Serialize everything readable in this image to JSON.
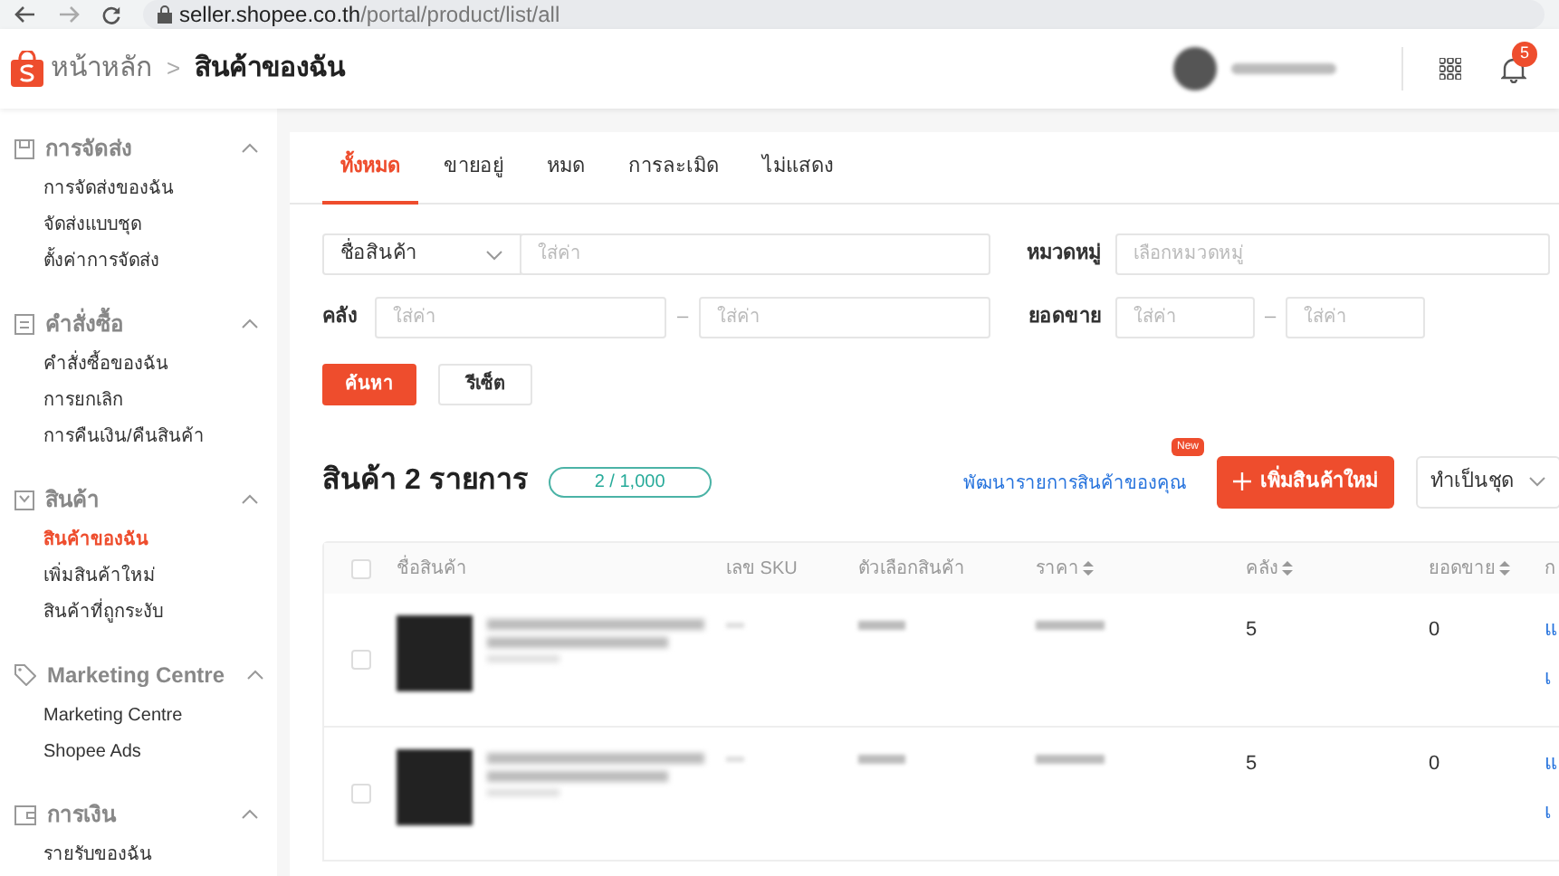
{
  "browser": {
    "url_host": "seller.shopee.co.th",
    "url_path": "/portal/product/list/all"
  },
  "header": {
    "breadcrumb": [
      {
        "label": "หน้าหลัก",
        "current": false
      },
      {
        "label": "สินค้าของฉัน",
        "current": true
      }
    ],
    "separator": ">",
    "notifications": "5"
  },
  "sidebar": [
    {
      "title": "การจัดส่ง",
      "items": [
        {
          "label": "การจัดส่งของฉัน",
          "selected": false
        },
        {
          "label": "จัดส่งแบบชุด",
          "selected": false
        },
        {
          "label": "ตั้งค่าการจัดส่ง",
          "selected": false
        }
      ]
    },
    {
      "title": "คำสั่งซื้อ",
      "items": [
        {
          "label": "คำสั่งซื้อของฉัน",
          "selected": false
        },
        {
          "label": "การยกเลิก",
          "selected": false
        },
        {
          "label": "การคืนเงิน/คืนสินค้า",
          "selected": false
        }
      ]
    },
    {
      "title": "สินค้า",
      "items": [
        {
          "label": "สินค้าของฉัน",
          "selected": true
        },
        {
          "label": "เพิ่มสินค้าใหม่",
          "selected": false
        },
        {
          "label": "สินค้าที่ถูกระงับ",
          "selected": false
        }
      ]
    },
    {
      "title": "Marketing Centre",
      "items": [
        {
          "label": "Marketing Centre",
          "selected": false
        },
        {
          "label": "Shopee Ads",
          "selected": false
        }
      ]
    },
    {
      "title": "การเงิน",
      "items": [
        {
          "label": "รายรับของฉัน",
          "selected": false
        }
      ]
    }
  ],
  "tabs": [
    {
      "label": "ทั้งหมด",
      "selected": true
    },
    {
      "label": "ขายอยู่",
      "selected": false
    },
    {
      "label": "หมด",
      "selected": false
    },
    {
      "label": "การละเมิด",
      "selected": false
    },
    {
      "label": "ไม่แสดง",
      "selected": false
    }
  ],
  "filters": {
    "search_type": "ชื่อสินค้า",
    "search_placeholder": "ใส่ค่า",
    "stock_label": "คลัง",
    "stock_min_placeholder": "ใส่ค่า",
    "stock_max_placeholder": "ใส่ค่า",
    "range_dash": "–",
    "category_label": "หมวดหมู่",
    "category_placeholder": "เลือกหมวดหมู่",
    "sales_label": "ยอดขาย",
    "sales_min_placeholder": "ใส่ค่า",
    "sales_max_placeholder": "ใส่ค่า",
    "search_button": "ค้นหา",
    "reset_button": "รีเซ็ต"
  },
  "list_header": {
    "title": "สินค้า 2 รายการ",
    "quota": "2 / 1,000",
    "improve_link": "พัฒนารายการสินค้าของคุณ",
    "new_badge": "New",
    "add_button": "เพิ่มสินค้าใหม่",
    "bulk_button": "ทำเป็นชุด"
  },
  "table": {
    "select_all_checked": false,
    "columns": [
      {
        "label": "ชื่อสินค้า",
        "sortable": false
      },
      {
        "label": "เลข SKU",
        "sortable": false
      },
      {
        "label": "ตัวเลือกสินค้า",
        "sortable": false
      },
      {
        "label": "ราคา",
        "sortable": true
      },
      {
        "label": "คลัง",
        "sortable": true
      },
      {
        "label": "ยอดขาย",
        "sortable": true
      },
      {
        "label": "ก",
        "sortable": false
      }
    ],
    "rows": [
      {
        "checked": false,
        "stock": "5",
        "sales": "0",
        "actions": [
          "แ",
          "เ"
        ]
      },
      {
        "checked": false,
        "stock": "5",
        "sales": "0",
        "actions": [
          "แ",
          "เ"
        ]
      }
    ]
  }
}
